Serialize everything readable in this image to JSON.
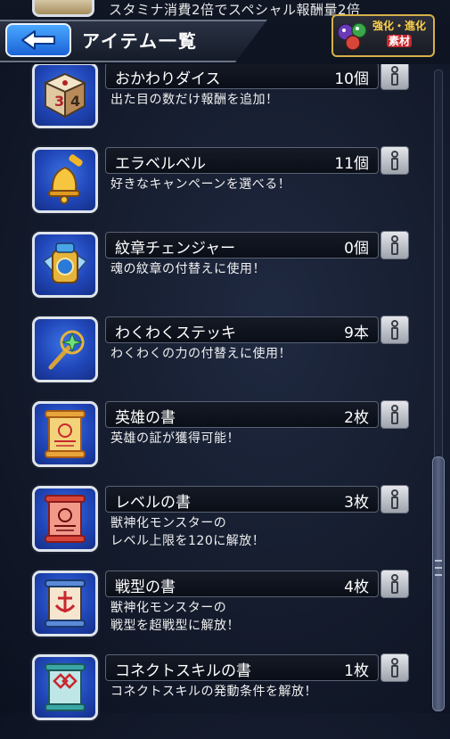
{
  "header": {
    "title": "アイテム一覧",
    "partial_desc": "スタミナ消費2倍でスペシャル報酬量2倍",
    "badge": {
      "line1": "強化・進化",
      "line2": "素材"
    }
  },
  "items": [
    {
      "name": "おかわりダイス",
      "count": "10個",
      "desc": "出た目の数だけ報酬を追加！",
      "icon": "dice-icon"
    },
    {
      "name": "エラベルベル",
      "count": "11個",
      "desc": "好きなキャンペーンを選べる！",
      "icon": "bell-icon"
    },
    {
      "name": "紋章チェンジャー",
      "count": "0個",
      "desc": "魂の紋章の付替えに使用！",
      "icon": "emblem-changer-icon"
    },
    {
      "name": "わくわくステッキ",
      "count": "9本",
      "desc": "わくわくの力の付替えに使用！",
      "icon": "wand-icon"
    },
    {
      "name": "英雄の書",
      "count": "2枚",
      "desc": "英雄の証が獲得可能！",
      "icon": "hero-scroll-icon"
    },
    {
      "name": "レベルの書",
      "count": "3枚",
      "desc": "獣神化モンスターの\nレベル上限を120に解放！",
      "icon": "level-scroll-icon"
    },
    {
      "name": "戦型の書",
      "count": "4枚",
      "desc": "獣神化モンスターの\n戦型を超戦型に解放！",
      "icon": "battle-type-scroll-icon"
    },
    {
      "name": "コネクトスキルの書",
      "count": "1枚",
      "desc": "コネクトスキルの発動条件を解放！",
      "icon": "connect-skill-scroll-icon"
    }
  ]
}
